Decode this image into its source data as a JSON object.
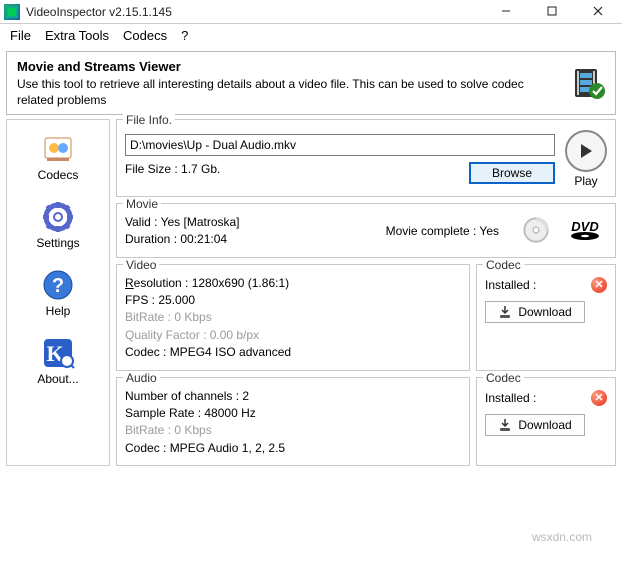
{
  "titlebar": {
    "title": "VideoInspector v2.15.1.145"
  },
  "menu": {
    "file": "File",
    "extra": "Extra Tools",
    "codecs": "Codecs",
    "help": "?"
  },
  "header": {
    "title": "Movie and Streams Viewer",
    "desc": "Use this tool to retrieve all interesting details about a video file. This can be used to solve codec related problems"
  },
  "sidebar": {
    "codecs": "Codecs",
    "settings": "Settings",
    "help": "Help",
    "about": "About..."
  },
  "fileinfo": {
    "legend": "File Info.",
    "path": "D:\\movies\\Up - Dual Audio.mkv",
    "filesize_label": "File Size : 1.7 Gb.",
    "browse": "Browse",
    "play": "Play"
  },
  "movie": {
    "legend": "Movie",
    "valid": "Valid : Yes [Matroska]",
    "duration": "Duration : 00:21:04",
    "complete": "Movie complete : Yes"
  },
  "video": {
    "legend": "Video",
    "resolution": "esolution : 1280x690 (1.86:1)",
    "res_prefix": "R",
    "fps": "FPS : 25.000",
    "bitrate": "BitRate : 0 Kbps",
    "qf": "Quality Factor : 0.00 b/px",
    "codec": "Codec : MPEG4 ISO advanced"
  },
  "audio": {
    "legend": "Audio",
    "channels": "Number of channels : 2",
    "sample": "Sample Rate : 48000 Hz",
    "bitrate": "BitRate : 0 Kbps",
    "codec": "Codec : MPEG Audio 1, 2, 2.5"
  },
  "codec_panel": {
    "legend": "Codec",
    "installed": "Installed :",
    "download": "Download"
  },
  "watermark": "wsxdn.com"
}
